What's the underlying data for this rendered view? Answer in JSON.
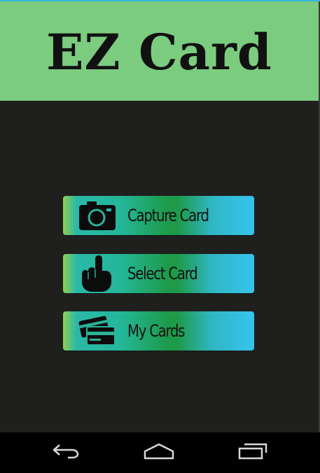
{
  "header": {
    "title": "EZ Card"
  },
  "menu": {
    "items": [
      {
        "label": "Capture  Card",
        "icon": "camera-icon"
      },
      {
        "label": "Select Card",
        "icon": "pointing-hand-icon"
      },
      {
        "label": "My Cards",
        "icon": "cards-icon"
      }
    ]
  },
  "navigation_bar": {
    "buttons": [
      "back-icon",
      "home-icon",
      "recents-icon"
    ]
  },
  "colors": {
    "header_background": "#7ccc80",
    "screen_background": "#1f201e",
    "button_gradient": [
      "#8ed14f",
      "#23b79a",
      "#1e9a4a",
      "#35c4ee"
    ],
    "status_accent": "#35b4e6"
  }
}
